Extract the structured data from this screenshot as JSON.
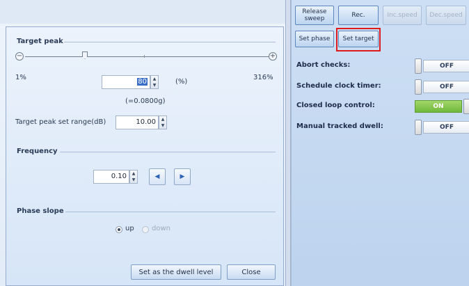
{
  "toolbar": {
    "release_sweep": "Release sweep",
    "rec": "Rec.",
    "inc_speed": "Inc.speed",
    "dec_speed": "Dec.speed",
    "set_phase": "Set phase",
    "set_target": "Set target"
  },
  "status": [
    {
      "label": "Abort checks:",
      "state": "OFF"
    },
    {
      "label": "Schedule clock timer:",
      "state": "OFF"
    },
    {
      "label": "Closed loop control:",
      "state": "ON"
    },
    {
      "label": "Manual tracked dwell:",
      "state": "OFF"
    }
  ],
  "dialog": {
    "target_peak": {
      "title": "Target peak",
      "min_label": "1%",
      "max_label": "316%",
      "value": "80",
      "unit": "(%)",
      "g_value": "(=0.0800g)",
      "minus_icon": "minus-circle-icon",
      "plus_icon": "plus-circle-icon"
    },
    "set_range": {
      "label": "Target peak set range(dB)",
      "value": "10.00"
    },
    "frequency": {
      "title": "Frequency",
      "value": "0.10",
      "prev_glyph": "◀",
      "next_glyph": "▶"
    },
    "phase_slope": {
      "title": "Phase slope",
      "options": [
        {
          "label": "up",
          "checked": true
        },
        {
          "label": "down",
          "checked": false
        }
      ]
    },
    "buttons": {
      "set_dwell": "Set as the dwell level",
      "close": "Close"
    }
  },
  "colors": {
    "highlight": "#dd1b1b",
    "on_toggle": "#7dc043"
  }
}
